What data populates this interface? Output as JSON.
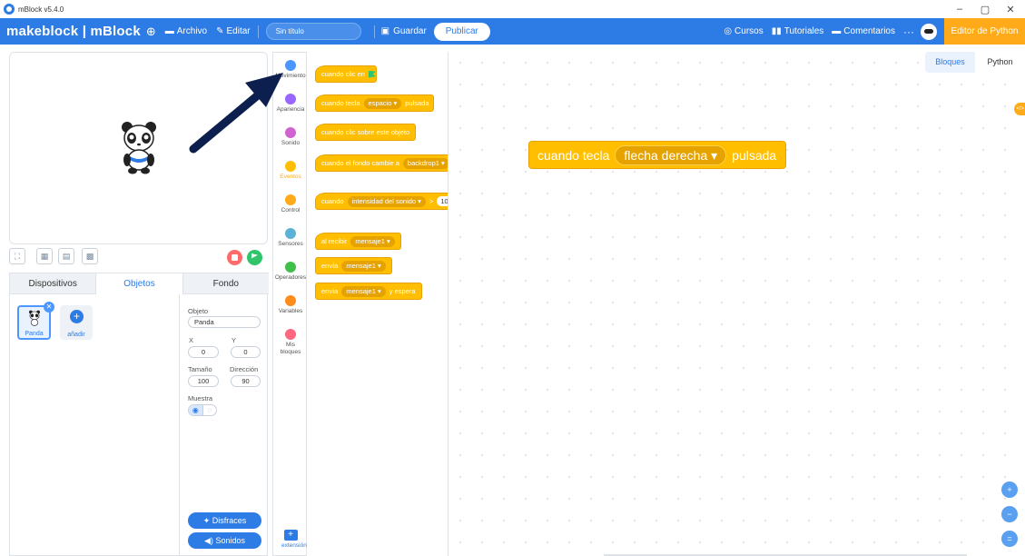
{
  "window": {
    "title": "mBlock v5.4.0",
    "minimize": "–",
    "maximize": "▢",
    "close": "✕"
  },
  "menubar": {
    "brand": "makeblock | mBlock",
    "globe": "⊕",
    "file": "Archivo",
    "edit": "Editar",
    "title_value": "Sin título",
    "save": "Guardar",
    "publish": "Publicar",
    "courses": "Cursos",
    "tutorials": "Tutoriales",
    "comments": "Comentarios",
    "more": "···",
    "python_editor": "Editor de Python"
  },
  "stage_controls": {
    "fullscreen": "⛶",
    "layout_small": "▦",
    "layout_large": "▤",
    "grid": "▩"
  },
  "sprite_panel": {
    "tabs": [
      "Dispositivos",
      "Objetos",
      "Fondo"
    ],
    "active_tab": "Objetos",
    "sprite_name": "Panda",
    "add_label": "añadir",
    "props": {
      "object_label": "Objeto",
      "object_value": "Panda",
      "x_label": "X",
      "x_value": "0",
      "y_label": "Y",
      "y_value": "0",
      "size_label": "Tamaño",
      "size_value": "100",
      "direction_label": "Dirección",
      "direction_value": "90",
      "show_label": "Muestra"
    },
    "costumes_button": "Disfraces",
    "sounds_button": "Sonidos"
  },
  "categories": [
    {
      "label": "Movimiento",
      "color": "#4c97ff"
    },
    {
      "label": "Apariencia",
      "color": "#9966ff"
    },
    {
      "label": "Sonido",
      "color": "#cf63cf"
    },
    {
      "label": "Eventos",
      "color": "#ffbf00"
    },
    {
      "label": "Control",
      "color": "#ffab19"
    },
    {
      "label": "Sensores",
      "color": "#5cb1d6"
    },
    {
      "label": "Operadores",
      "color": "#40bf4a"
    },
    {
      "label": "Variables",
      "color": "#ff8c1a"
    },
    {
      "label": "Mis bloques",
      "color": "#ff6680"
    }
  ],
  "active_category": "Eventos",
  "extension_label": "extensión",
  "palette": {
    "b1": "cuando clic en",
    "b2_pre": "cuando tecla",
    "b2_dd": "espacio ▾",
    "b2_post": "pulsada",
    "b3": "cuando clic sobre este objeto",
    "b4_pre": "cuando el fondo cambie a",
    "b4_dd": "backdrop1 ▾",
    "b5_pre": "cuando",
    "b5_dd": "intensidad del sonido ▾",
    "b5_op": ">",
    "b5_num": "10",
    "b6_pre": "al recibir",
    "b6_dd": "mensaje1 ▾",
    "b7_pre": "envía",
    "b7_dd": "mensaje1 ▾",
    "b8_pre": "envía",
    "b8_dd": "mensaje1 ▾",
    "b8_post": "y espera"
  },
  "workspace": {
    "tabs": [
      "Bloques",
      "Python"
    ],
    "active_tab": "Bloques",
    "code_toggle": "</>",
    "block_pre": "cuando tecla",
    "block_dd": "flecha derecha ▾",
    "block_post": "pulsada",
    "zoom_in": "+",
    "zoom_out": "−",
    "zoom_reset": "="
  },
  "colors": {
    "accent": "#2d7be5",
    "events": "#ffbf00",
    "python_btn": "#ffab19",
    "arrow": "#0d1f4e"
  }
}
